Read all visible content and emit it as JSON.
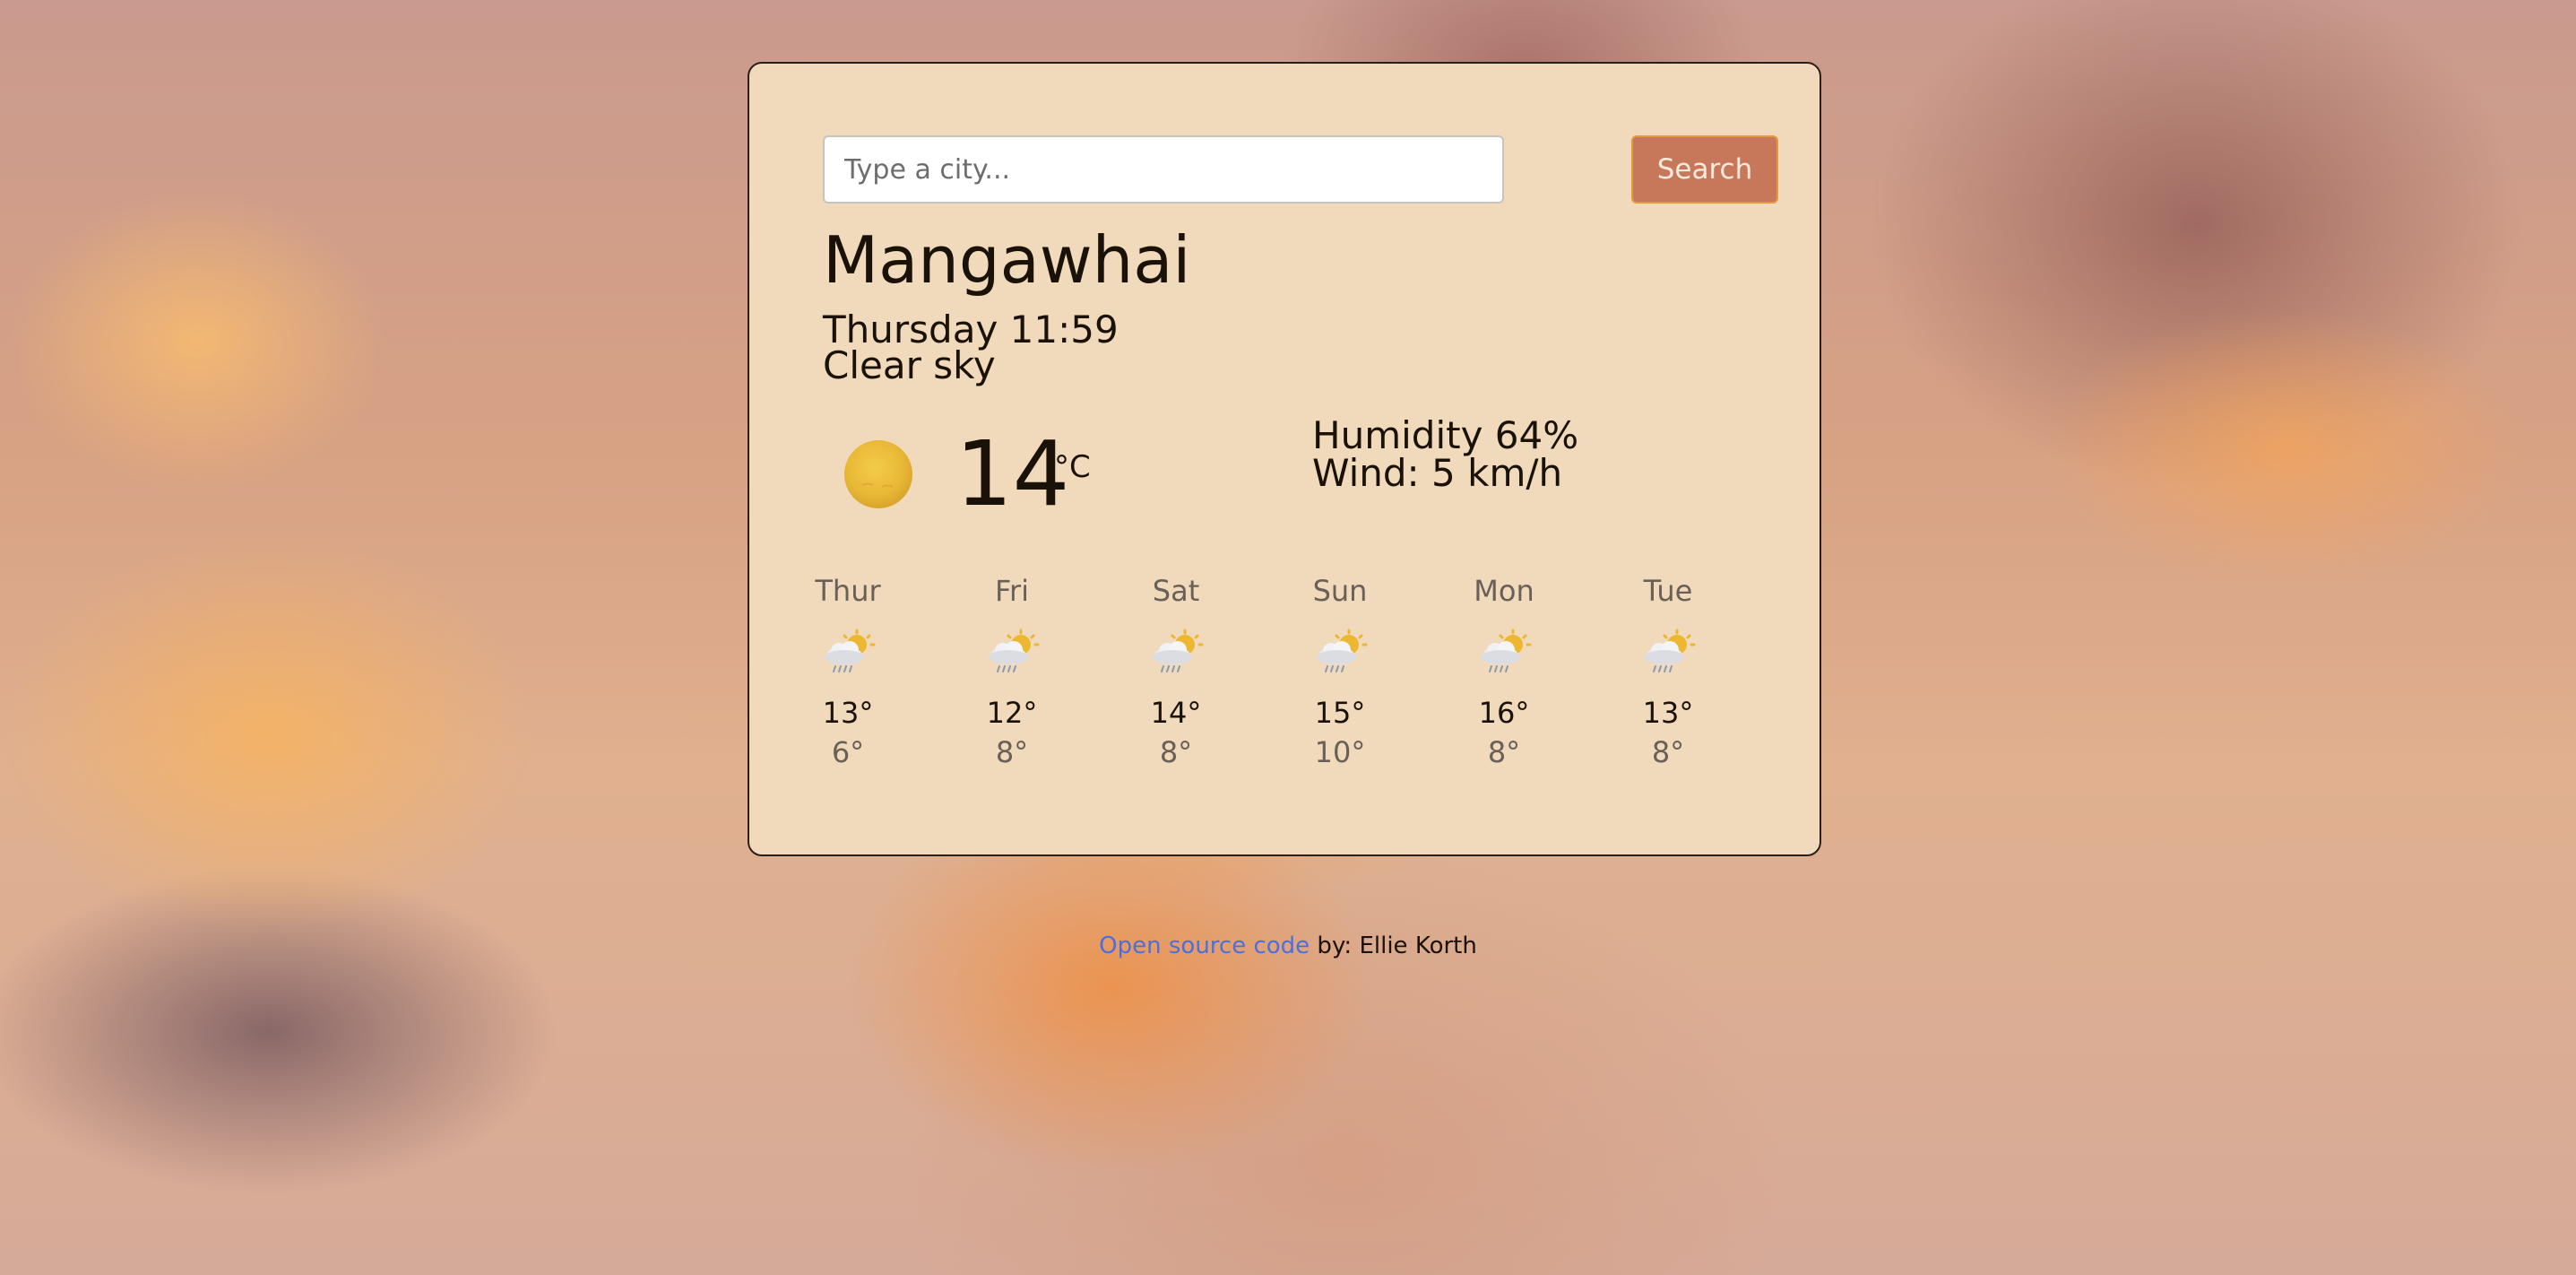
{
  "search": {
    "placeholder": "Type a city...",
    "button_label": "Search"
  },
  "current": {
    "city": "Mangawhai",
    "datetime": "Thursday 11:59",
    "description": "Clear sky",
    "icon": "sun-icon",
    "temperature": "14",
    "unit": "°C",
    "humidity": "Humidity 64%",
    "wind": "Wind: 5 km/h"
  },
  "forecast": [
    {
      "day": "Thur",
      "max": "13°",
      "min": "6°",
      "icon": "rain-sun-icon"
    },
    {
      "day": "Fri",
      "max": "12°",
      "min": "8°",
      "icon": "rain-sun-icon"
    },
    {
      "day": "Sat",
      "max": "14°",
      "min": "8°",
      "icon": "rain-sun-icon"
    },
    {
      "day": "Sun",
      "max": "15°",
      "min": "10°",
      "icon": "rain-sun-icon"
    },
    {
      "day": "Mon",
      "max": "16°",
      "min": "8°",
      "icon": "rain-sun-icon"
    },
    {
      "day": "Tue",
      "max": "13°",
      "min": "8°",
      "icon": "rain-sun-icon"
    }
  ],
  "footer": {
    "link_text": "Open source code",
    "suffix": " by: Ellie Korth"
  },
  "colors": {
    "card_background": "#f0dabb",
    "button_background": "#c8785a",
    "button_border": "#e39a3d",
    "link": "#4a6fe0"
  }
}
